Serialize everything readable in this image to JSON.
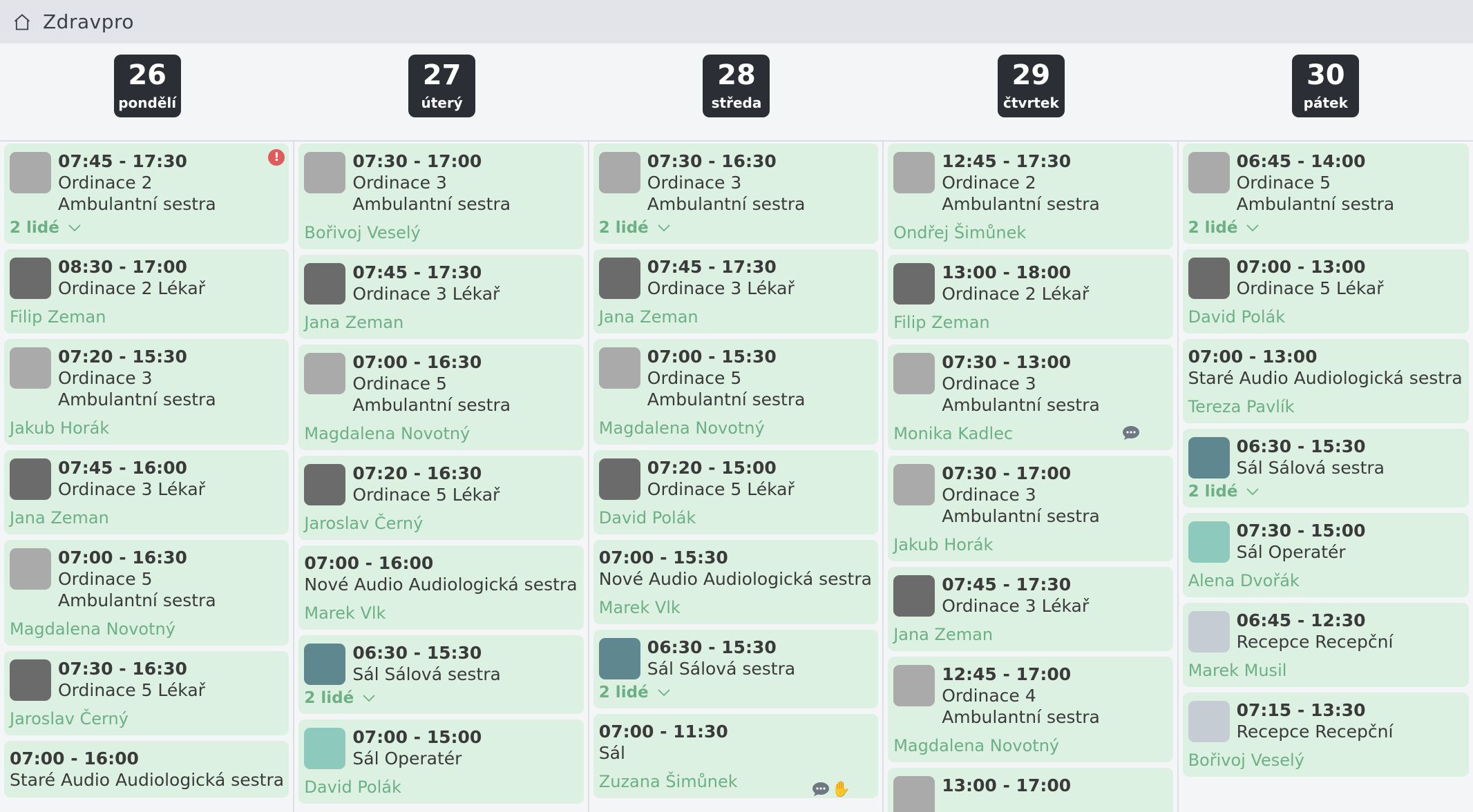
{
  "app": {
    "title": "Zdravpro"
  },
  "days": [
    {
      "num": "26",
      "weekday": "pondělí"
    },
    {
      "num": "27",
      "weekday": "úterý"
    },
    {
      "num": "28",
      "weekday": "středa"
    },
    {
      "num": "29",
      "weekday": "čtvrtek"
    },
    {
      "num": "30",
      "weekday": "pátek"
    }
  ],
  "columns": [
    {
      "shifts": [
        {
          "avatar": "light",
          "time": "07:45 - 17:30",
          "lines": [
            "Ordinace 2",
            "Ambulantní sestra"
          ],
          "people": "2 lidé",
          "alert": "!"
        },
        {
          "avatar": "dark",
          "time": "08:30 - 17:00",
          "lines": [
            "Ordinace 2 Lékař"
          ],
          "person": "Filip Zeman"
        },
        {
          "avatar": "light",
          "time": "07:20 - 15:30",
          "lines": [
            "Ordinace 3",
            "Ambulantní sestra"
          ],
          "person": "Jakub Horák"
        },
        {
          "avatar": "dark",
          "time": "07:45 - 16:00",
          "lines": [
            "Ordinace 3 Lékař"
          ],
          "person": "Jana Zeman"
        },
        {
          "avatar": "light",
          "time": "07:00 - 16:30",
          "lines": [
            "Ordinace 5",
            "Ambulantní sestra"
          ],
          "person": "Magdalena Novotný"
        },
        {
          "avatar": "dark",
          "time": "07:30 - 16:30",
          "lines": [
            "Ordinace 5 Lékař"
          ],
          "person": "Jaroslav Černý"
        },
        {
          "avatar": "",
          "time": "07:00 - 16:00",
          "lines": [
            "Staré Audio Audiologická sestra"
          ],
          "person": ""
        }
      ]
    },
    {
      "shifts": [
        {
          "avatar": "light",
          "time": "07:30 - 17:00",
          "lines": [
            "Ordinace 3",
            "Ambulantní sestra"
          ],
          "person": "Bořivoj Veselý"
        },
        {
          "avatar": "dark",
          "time": "07:45 - 17:30",
          "lines": [
            "Ordinace 3 Lékař"
          ],
          "person": "Jana Zeman"
        },
        {
          "avatar": "light",
          "time": "07:00 - 16:30",
          "lines": [
            "Ordinace 5",
            "Ambulantní sestra"
          ],
          "person": "Magdalena Novotný"
        },
        {
          "avatar": "dark",
          "time": "07:20 - 16:30",
          "lines": [
            "Ordinace 5 Lékař"
          ],
          "person": "Jaroslav Černý"
        },
        {
          "avatar": "",
          "time": "07:00 - 16:00",
          "lines": [
            "Nové Audio Audiologická sestra"
          ],
          "person": "Marek Vlk"
        },
        {
          "avatar": "teal",
          "time": "06:30 - 15:30",
          "lines": [
            "Sál Sálová sestra"
          ],
          "people": "2 lidé"
        },
        {
          "avatar": "mint",
          "time": "07:00 - 15:00",
          "lines": [
            "Sál Operatér"
          ],
          "person": "David Polák"
        }
      ]
    },
    {
      "shifts": [
        {
          "avatar": "light",
          "time": "07:30 - 16:30",
          "lines": [
            "Ordinace 3",
            "Ambulantní sestra"
          ],
          "people": "2 lidé"
        },
        {
          "avatar": "dark",
          "time": "07:45 - 17:30",
          "lines": [
            "Ordinace 3 Lékař"
          ],
          "person": "Jana Zeman"
        },
        {
          "avatar": "light",
          "time": "07:00 - 15:30",
          "lines": [
            "Ordinace 5",
            "Ambulantní sestra"
          ],
          "person": "Magdalena Novotný"
        },
        {
          "avatar": "dark",
          "time": "07:20 - 15:00",
          "lines": [
            "Ordinace 5 Lékař"
          ],
          "person": "David Polák"
        },
        {
          "avatar": "",
          "time": "07:00 - 15:30",
          "lines": [
            "Nové Audio Audiologická sestra"
          ],
          "person": "Marek Vlk"
        },
        {
          "avatar": "teal",
          "time": "06:30 - 15:30",
          "lines": [
            "Sál Sálová sestra"
          ],
          "people": "2 lidé"
        },
        {
          "avatar": "",
          "time": "07:00 - 11:30",
          "lines": [
            "Sál"
          ],
          "person": "Zuzana Šimůnek",
          "comment": true,
          "clap": true
        }
      ]
    },
    {
      "shifts": [
        {
          "avatar": "light",
          "time": "12:45 - 17:30",
          "lines": [
            "Ordinace 2",
            "Ambulantní sestra"
          ],
          "person": "Ondřej Šimůnek"
        },
        {
          "avatar": "dark",
          "time": "13:00 - 18:00",
          "lines": [
            "Ordinace 2 Lékař"
          ],
          "person": "Filip Zeman"
        },
        {
          "avatar": "light",
          "time": "07:30 - 13:00",
          "lines": [
            "Ordinace 3",
            "Ambulantní sestra"
          ],
          "person": "Monika Kadlec",
          "comment": true
        },
        {
          "avatar": "light",
          "time": "07:30 - 17:00",
          "lines": [
            "Ordinace 3",
            "Ambulantní sestra"
          ],
          "person": "Jakub Horák"
        },
        {
          "avatar": "dark",
          "time": "07:45 - 17:30",
          "lines": [
            "Ordinace 3 Lékař"
          ],
          "person": "Jana Zeman"
        },
        {
          "avatar": "light",
          "time": "12:45 - 17:00",
          "lines": [
            "Ordinace 4",
            "Ambulantní sestra"
          ],
          "person": "Magdalena Novotný"
        },
        {
          "avatar": "light",
          "time": "13:00 - 17:00",
          "lines": [
            ""
          ],
          "person": ""
        }
      ]
    },
    {
      "shifts": [
        {
          "avatar": "light",
          "time": "06:45 - 14:00",
          "lines": [
            "Ordinace 5",
            "Ambulantní sestra"
          ],
          "people": "2 lidé"
        },
        {
          "avatar": "dark",
          "time": "07:00 - 13:00",
          "lines": [
            "Ordinace 5 Lékař"
          ],
          "person": "David Polák"
        },
        {
          "avatar": "",
          "time": "07:00 - 13:00",
          "lines": [
            "Staré Audio Audiologická sestra"
          ],
          "person": "Tereza Pavlík"
        },
        {
          "avatar": "teal",
          "time": "06:30 - 15:30",
          "lines": [
            "Sál Sálová sestra"
          ],
          "people": "2 lidé"
        },
        {
          "avatar": "mint",
          "time": "07:30 - 15:00",
          "lines": [
            "Sál Operatér"
          ],
          "person": "Alena Dvořák"
        },
        {
          "avatar": "pale",
          "time": "06:45 - 12:30",
          "lines": [
            "Recepce Recepční"
          ],
          "person": "Marek Musil"
        },
        {
          "avatar": "pale",
          "time": "07:15 - 13:30",
          "lines": [
            "Recepce Recepční"
          ],
          "person": "Bořivoj Veselý"
        }
      ]
    }
  ]
}
